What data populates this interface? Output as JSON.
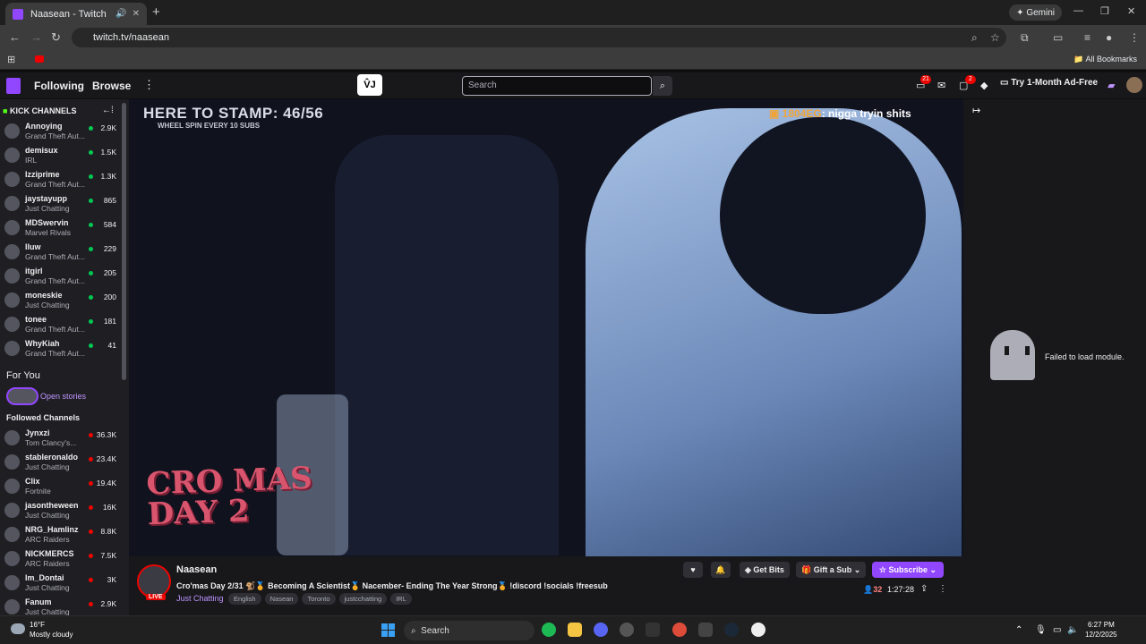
{
  "browser": {
    "tab_title": "Naasean - Twitch",
    "url": "twitch.tv/naasean",
    "gemini_label": "Gemini",
    "bookmarks_label": "All Bookmarks"
  },
  "twitch_nav": {
    "following": "Following",
    "browse": "Browse",
    "search_placeholder": "Search",
    "notif_count": "21",
    "whispers_count": "2",
    "try_ad_free": "Try 1-Month Ad-Free"
  },
  "sidebar": {
    "kick_header": "KICK CHANNELS",
    "kick_channels": [
      {
        "name": "Annoying",
        "game": "Grand Theft Aut...",
        "viewers": "2.9K"
      },
      {
        "name": "demisux",
        "game": "IRL",
        "viewers": "1.5K"
      },
      {
        "name": "Izziprime",
        "game": "Grand Theft Aut...",
        "viewers": "1.3K"
      },
      {
        "name": "jaystayupp",
        "game": "Just Chatting",
        "viewers": "865"
      },
      {
        "name": "MDSwervin",
        "game": "Marvel Rivals",
        "viewers": "584"
      },
      {
        "name": "lluw",
        "game": "Grand Theft Aut...",
        "viewers": "229"
      },
      {
        "name": "itgirl",
        "game": "Grand Theft Aut...",
        "viewers": "205"
      },
      {
        "name": "moneskie",
        "game": "Just Chatting",
        "viewers": "200"
      },
      {
        "name": "tonee",
        "game": "Grand Theft Aut...",
        "viewers": "181"
      },
      {
        "name": "WhyKiah",
        "game": "Grand Theft Aut...",
        "viewers": "41"
      }
    ],
    "for_you": "For You",
    "open_stories": "Open stories",
    "followed_header": "Followed Channels",
    "followed_channels": [
      {
        "name": "Jynxzi",
        "game": "Tom Clancy's...",
        "viewers": "36.3K"
      },
      {
        "name": "stableronaldo",
        "game": "Just Chatting",
        "viewers": "23.4K"
      },
      {
        "name": "Clix",
        "game": "Fortnite",
        "viewers": "19.4K"
      },
      {
        "name": "jasontheween",
        "game": "Just Chatting",
        "viewers": "16K"
      },
      {
        "name": "NRG_Hamlinz",
        "game": "ARC Raiders",
        "viewers": "8.8K"
      },
      {
        "name": "NICKMERCS",
        "game": "ARC Raiders",
        "viewers": "7.5K"
      },
      {
        "name": "lm_Dontai",
        "game": "Just Chatting",
        "viewers": "3K"
      },
      {
        "name": "Fanum",
        "game": "Just Chatting",
        "viewers": "2.9K"
      }
    ]
  },
  "player": {
    "stamp_text": "HERE TO STAMP: 46/56",
    "stamp_sub": "WHEEL SPIN EVERY 10 SUBS",
    "chat_user": "1804EG",
    "chat_msg": ": nigga tryin shits",
    "overlay_art": "CRO MAS DAY 2"
  },
  "right_panel": {
    "error": "Failed to load module."
  },
  "stream_info": {
    "live_badge": "LIVE",
    "streamer": "Naasean",
    "title": "Cro'mas Day 2/31 🐒🏅 Becoming A Scientist🏅 Nacember- Ending The Year Strong🏅 !discord !socials !freesub",
    "category": "Just Chatting",
    "tags": [
      "English",
      "Nasean",
      "Toronto",
      "justcchatting",
      "IRL"
    ],
    "get_bits": "Get Bits",
    "gift_sub": "Gift a Sub",
    "subscribe": "Subscribe",
    "viewers": "32",
    "uptime": "1:27:28"
  },
  "taskbar": {
    "temp": "16°F",
    "weather": "Mostly cloudy",
    "search": "Search",
    "time": "6:27 PM",
    "date": "12/2/2025"
  },
  "colors": {
    "twitch_purple": "#9146ff",
    "live_red": "#eb0400",
    "online_green": "#00c853"
  }
}
